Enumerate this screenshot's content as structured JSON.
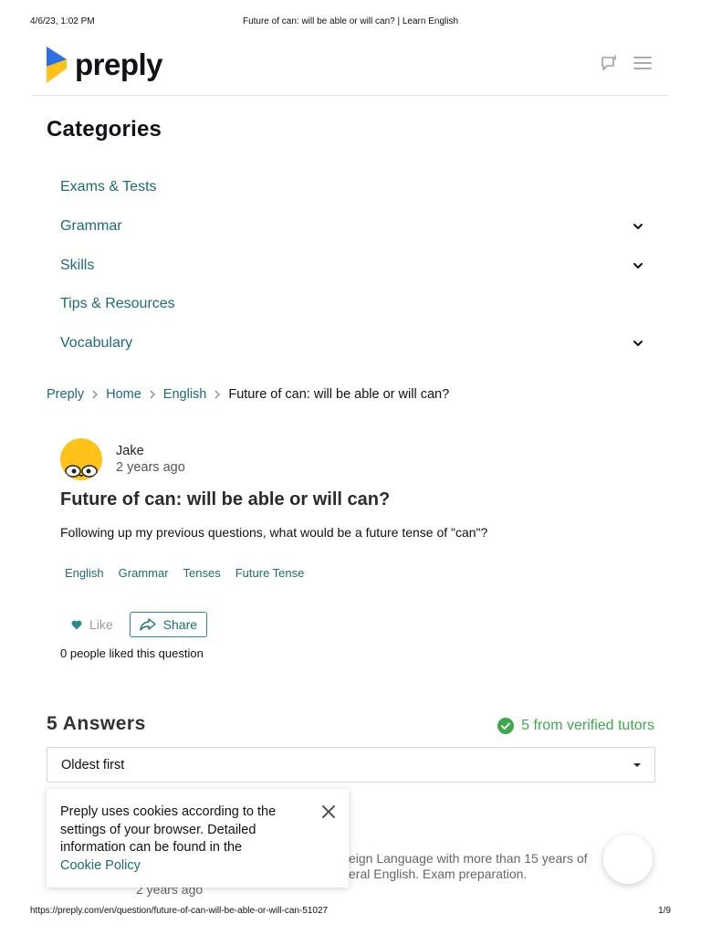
{
  "print": {
    "date": "4/6/23, 1:02 PM",
    "title": "Future of can: will be able or will can? | Learn English",
    "url": "https://preply.com/en/question/future-of-can-will-be-able-or-will-can-51027",
    "page": "1/9"
  },
  "brand": {
    "name": "preply",
    "colors": {
      "accent": "#1d6b74",
      "logo_blue": "#2f6fe4",
      "logo_yellow": "#ffc21a",
      "verified": "#3fa84c"
    }
  },
  "header": {
    "icons": [
      "chat-icon",
      "menu-icon"
    ]
  },
  "categories": {
    "title": "Categories",
    "items": [
      {
        "label": "Exams & Tests",
        "expandable": false
      },
      {
        "label": "Grammar",
        "expandable": true
      },
      {
        "label": "Skills",
        "expandable": true
      },
      {
        "label": "Tips & Resources",
        "expandable": false
      },
      {
        "label": "Vocabulary",
        "expandable": true
      }
    ]
  },
  "breadcrumb": {
    "items": [
      "Preply",
      "Home",
      "English"
    ],
    "current": "Future of can: will be able or will can?"
  },
  "question": {
    "author": "Jake",
    "time": "2 years ago",
    "title": "Future of can: will be able or will can?",
    "body": "Following up my previous questions, what would be a future tense of \"can\"?",
    "tags": [
      "English",
      "Grammar",
      "Tenses",
      "Future Tense"
    ],
    "like_label": "Like",
    "share_label": "Share",
    "likes_text": "0 people liked this question"
  },
  "answers": {
    "title": "5 Answers",
    "verified_text": "5 from verified tutors",
    "sort": {
      "selected": "Oldest first"
    },
    "first": {
      "bio_line1": "eign Language with more than 15 years of",
      "bio_line2": "eral English. Exam preparation.",
      "time": "2 years ago"
    }
  },
  "cookie": {
    "text": "Preply uses cookies according to the settings of your browser. Detailed information can be found in the",
    "link": "Cookie Policy"
  }
}
